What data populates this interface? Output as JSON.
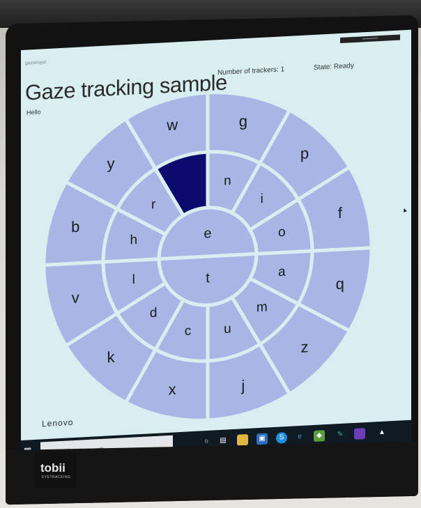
{
  "app": {
    "caption": "gazeinput",
    "title": "Gaze tracking sample",
    "trackers_label": "Number of trackers:",
    "trackers_value": "1",
    "state_label": "State:",
    "state_value": "Ready",
    "hello": "Hello"
  },
  "wheel": {
    "center_letters": [
      "e",
      "t"
    ],
    "middle_letters": [
      "n",
      "i",
      "o",
      "a",
      "m",
      "u",
      "c",
      "d",
      "l",
      "h",
      "r",
      ""
    ],
    "outer_letters": [
      "g",
      "p",
      "f",
      "q",
      "z",
      "j",
      "x",
      "k",
      "v",
      "b",
      "y",
      "w"
    ],
    "selected_cell": "middle-11",
    "cell_color": "#a8b6e6",
    "selected_color": "#0b0b6e",
    "gap_color": "#d9eef0"
  },
  "taskbar": {
    "search_placeholder": "Type here to search",
    "icons": [
      "task-view-icon",
      "file-explorer-icon",
      "store-icon",
      "skype-icon",
      "edge-icon",
      "app-icon",
      "tool-icon",
      "visual-studio-icon",
      "system-tray-icon"
    ]
  },
  "hardware": {
    "laptop_brand": "Lenovo",
    "tracker_brand": "tobii",
    "tracker_sub": "EYETRACKING"
  }
}
